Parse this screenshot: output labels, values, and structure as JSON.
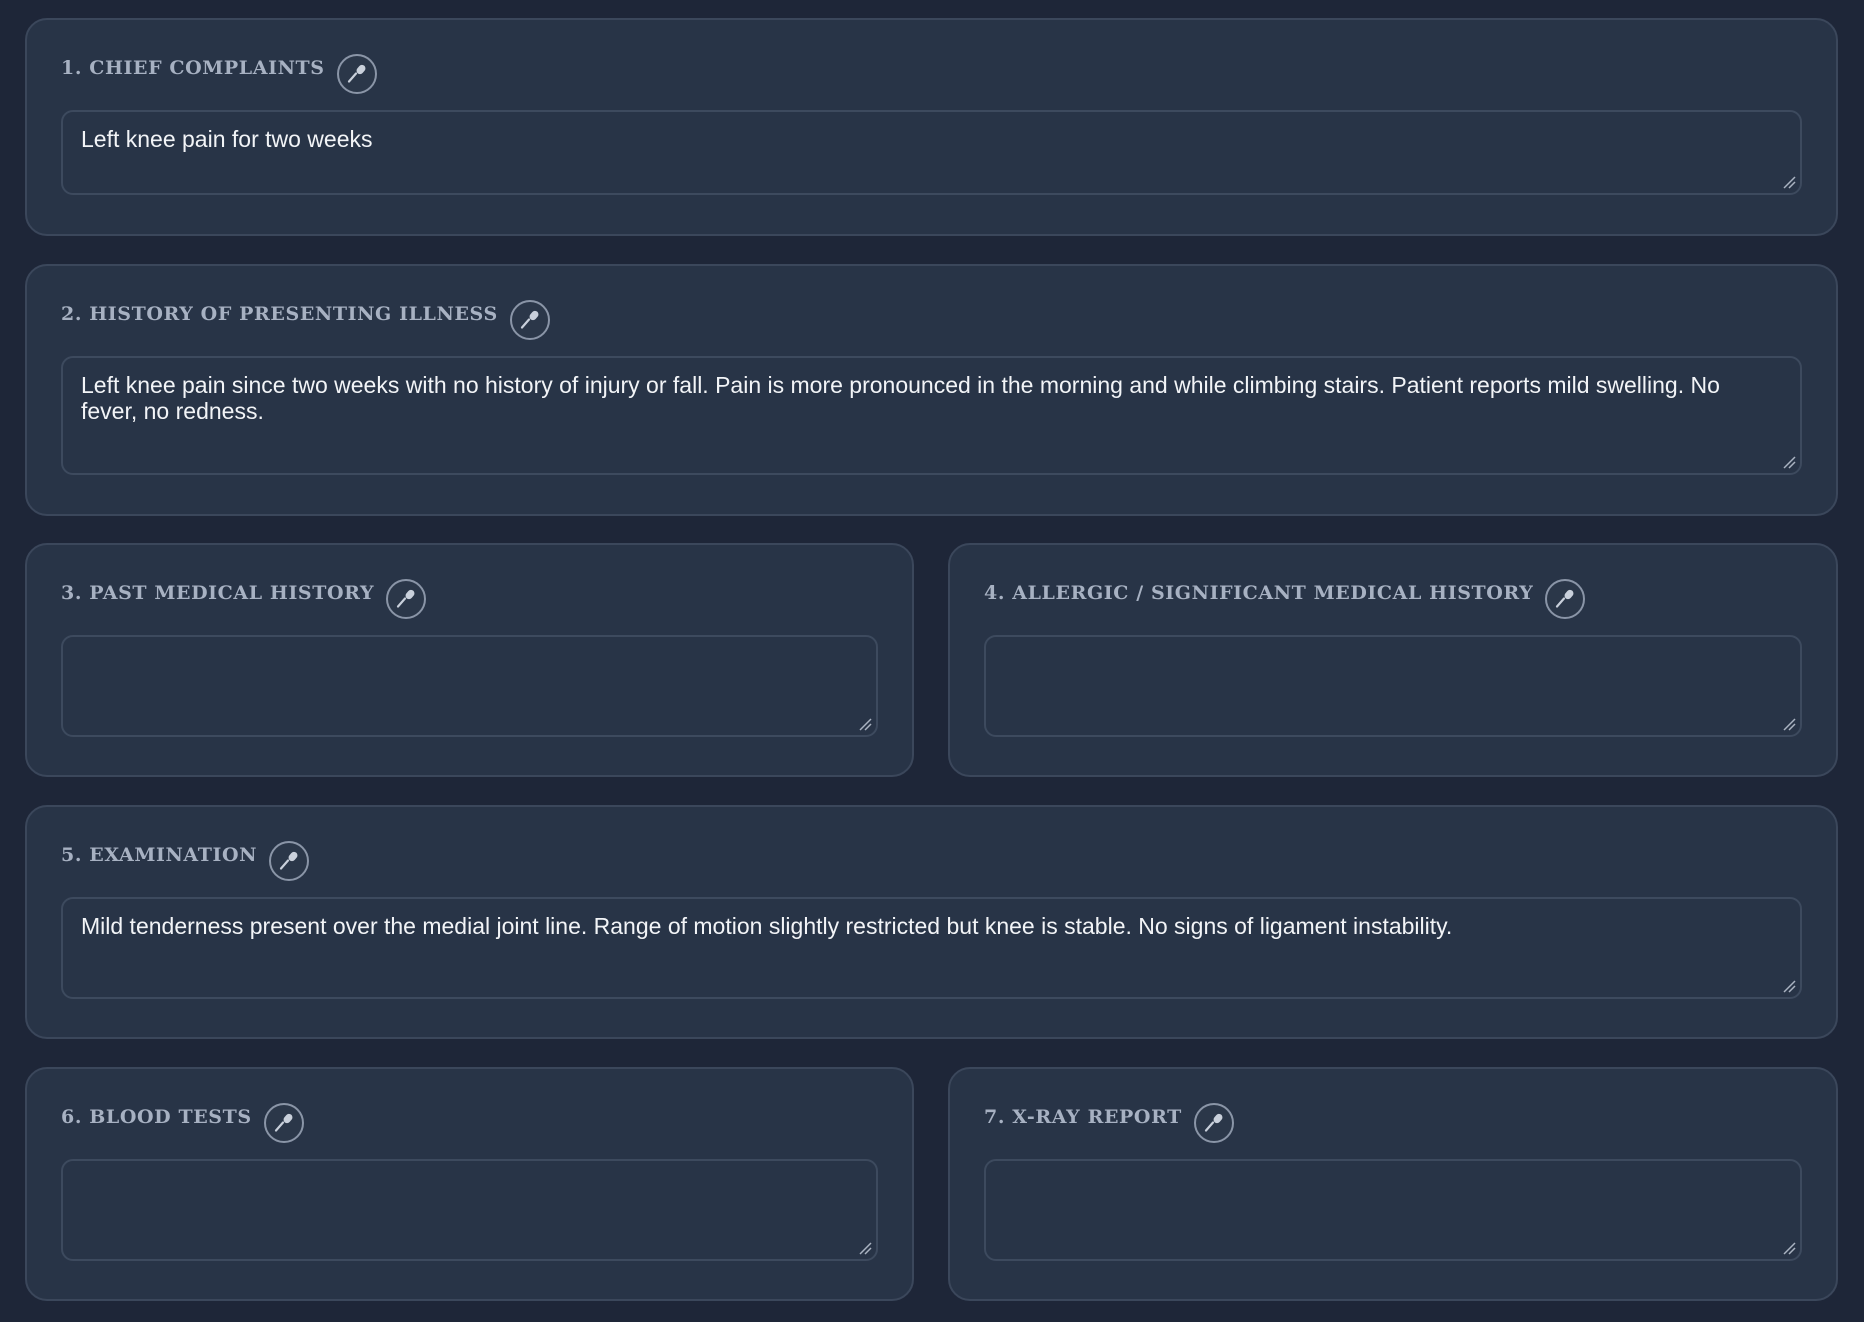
{
  "sections": [
    {
      "title": "1. CHIEF COMPLAINTS",
      "value": "Left knee pain for two weeks"
    },
    {
      "title": "2. HISTORY OF PRESENTING ILLNESS",
      "value": "Left knee pain since two weeks with no history of injury or fall. Pain is more pronounced in the morning and while climbing stairs. Patient reports mild swelling. No fever, no redness."
    },
    {
      "title": "3. PAST MEDICAL HISTORY",
      "value": ""
    },
    {
      "title": "4. ALLERGIC / SIGNIFICANT MEDICAL HISTORY",
      "value": ""
    },
    {
      "title": "5. EXAMINATION",
      "value": "Mild tenderness present over the medial joint line. Range of motion slightly restricted but knee is stable. No signs of ligament instability."
    },
    {
      "title": "6. BLOOD TESTS",
      "value": ""
    },
    {
      "title": "7. X-RAY REPORT",
      "value": ""
    }
  ],
  "icons": {
    "mic": "microphone-icon",
    "resize": "resize-handle-icon"
  },
  "colors": {
    "background": "#1e2638",
    "card": "#283447",
    "border": "#3b475b",
    "label": "#a7b1c2",
    "text": "#f2f4f7"
  }
}
